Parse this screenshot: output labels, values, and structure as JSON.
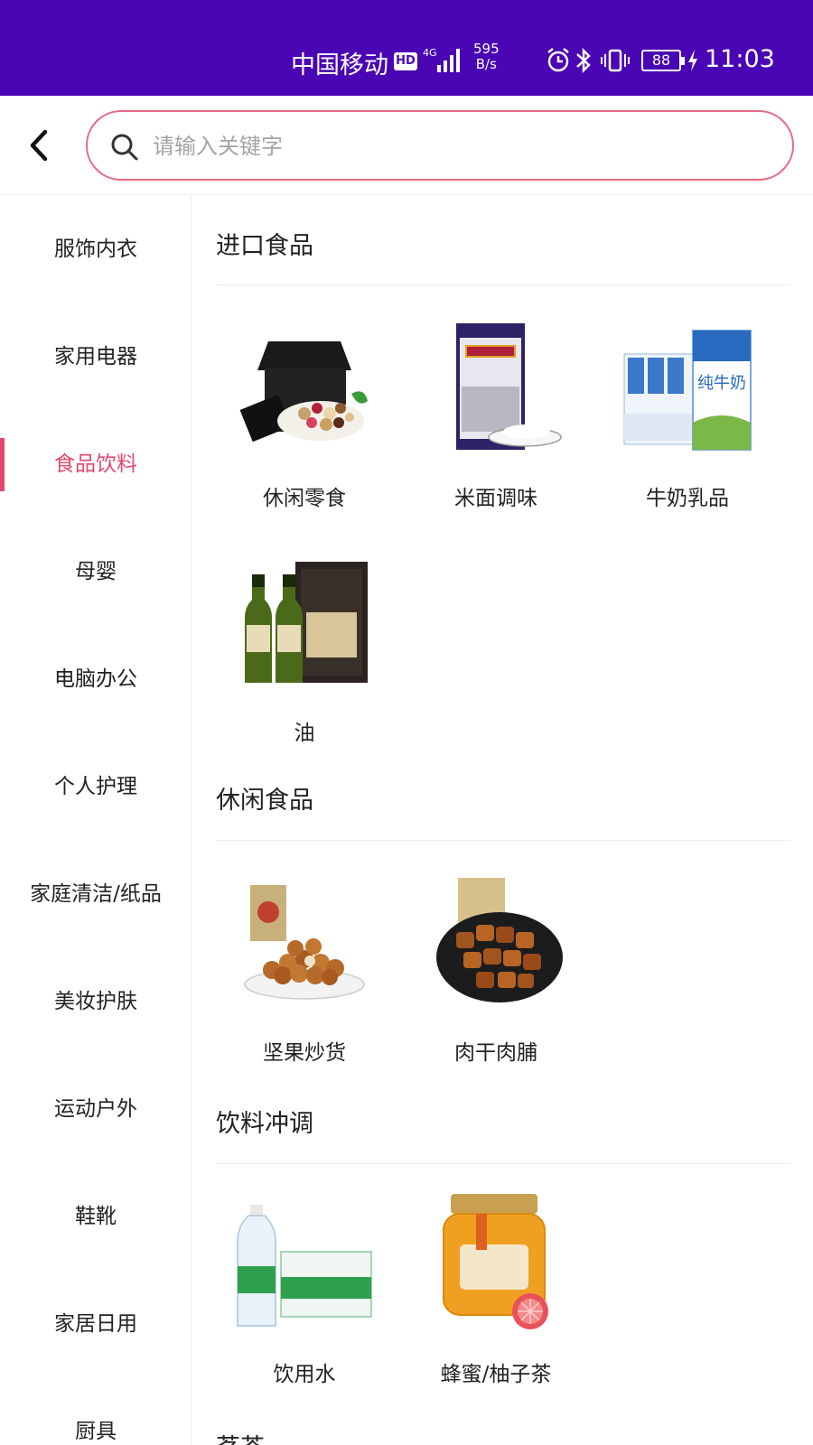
{
  "status_bar": {
    "carrier": "中国移动",
    "hd": "HD",
    "speed_value": "595",
    "speed_unit": "B/s",
    "battery": "88",
    "time": "11:03"
  },
  "search": {
    "placeholder": "请输入关键字"
  },
  "colors": {
    "status_bar": "#4a05b4",
    "accent": "#e4476d",
    "search_border": "#e56a84"
  },
  "sidebar": {
    "active_index": 2,
    "items": [
      {
        "label": "服饰内衣"
      },
      {
        "label": "家用电器"
      },
      {
        "label": "食品饮料"
      },
      {
        "label": "母婴"
      },
      {
        "label": "电脑办公"
      },
      {
        "label": "个人护理"
      },
      {
        "label": "家庭清洁/纸品"
      },
      {
        "label": "美妆护肤"
      },
      {
        "label": "运动户外"
      },
      {
        "label": "鞋靴"
      },
      {
        "label": "家居日用"
      },
      {
        "label": "厨具"
      }
    ]
  },
  "sections": [
    {
      "title": "进口食品",
      "items": [
        {
          "label": "休闲零食",
          "icon": "snack-gift-box-image"
        },
        {
          "label": "米面调味",
          "icon": "rice-bag-image"
        },
        {
          "label": "牛奶乳品",
          "icon": "milk-carton-image"
        },
        {
          "label": "油",
          "icon": "olive-oil-bottles-image"
        }
      ]
    },
    {
      "title": "休闲食品",
      "items": [
        {
          "label": "坚果炒货",
          "icon": "nuts-bowl-image"
        },
        {
          "label": "肉干肉脯",
          "icon": "jerky-bowl-image"
        }
      ]
    },
    {
      "title": "饮料冲调",
      "items": [
        {
          "label": "饮用水",
          "icon": "water-bottle-image"
        },
        {
          "label": "蜂蜜/柚子茶",
          "icon": "honey-jar-image"
        }
      ]
    },
    {
      "title": "茗茶",
      "items": []
    }
  ]
}
